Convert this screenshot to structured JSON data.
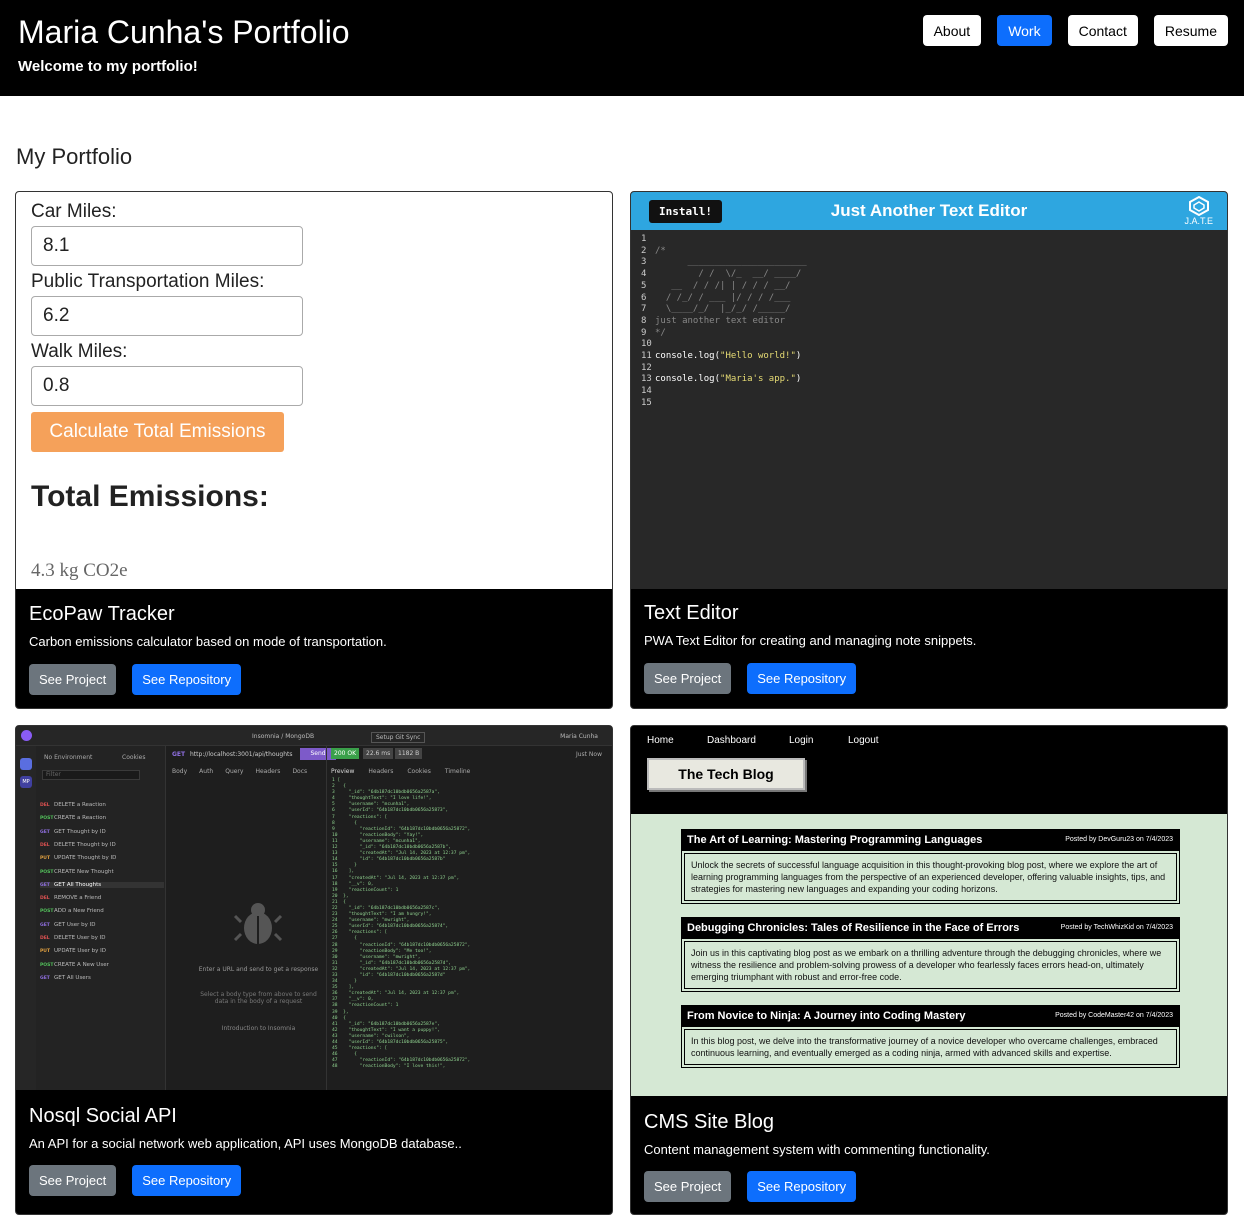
{
  "header": {
    "title": "Maria Cunha's Portfolio",
    "subtitle": "Welcome to my portfolio!",
    "nav": [
      {
        "label": "About",
        "active": false
      },
      {
        "label": "Work",
        "active": true
      },
      {
        "label": "Contact",
        "active": false
      },
      {
        "label": "Resume",
        "active": false
      }
    ]
  },
  "section_title": "My Portfolio",
  "buttons": {
    "project": "See Project",
    "repo": "See Repository"
  },
  "projects": [
    {
      "title": "EcoPaw Tracker",
      "description": "Carbon emissions calculator based on mode of transportation."
    },
    {
      "title": "Text Editor",
      "description": "PWA Text Editor for creating and managing note snippets."
    },
    {
      "title": "Nosql Social API",
      "description": "An API for a social network web application, API uses MongoDB database.."
    },
    {
      "title": "CMS Site Blog",
      "description": "Content management system with commenting functionality."
    }
  ],
  "eco": {
    "car_label": "Car Miles:",
    "car_value": "8.1",
    "public_label": "Public Transportation Miles:",
    "public_value": "6.2",
    "walk_label": "Walk Miles:",
    "walk_value": "0.8",
    "calc_button": "Calculate Total Emissions",
    "total_label": "Total Emissions:",
    "total_value": "4.3 kg CO2e"
  },
  "editor": {
    "install": "Install!",
    "title": "Just Another Text Editor",
    "logo_text": "J.A.T.E",
    "lines": [
      "1",
      "2",
      "3",
      "4",
      "5",
      "6",
      "7",
      "8",
      "9",
      "10",
      "11",
      "12",
      "13",
      "14",
      "15"
    ],
    "comment_open": "/*",
    "tagline": "just another text editor",
    "comment_close": "*/",
    "code1_fn": "console.log(",
    "code1_str": "\"Hello world!\"",
    "code1_end": ")",
    "code2_str": "\"Maria's app.\"",
    "code2_end": ")"
  },
  "nosql": {
    "app_title": "Insomnia / MongoDB",
    "env": "No Environment",
    "cookies": "Cookies",
    "filter": "Filter",
    "method": "GET",
    "url": "http://localhost:3001/api/thoughts",
    "send": "Send",
    "status": "200 OK",
    "time": "22.6 ms",
    "size": "1182 B",
    "just_now": "Just Now",
    "user": "Maria Cunha",
    "git": "Setup Git Sync",
    "tabs": [
      "Body",
      "Auth",
      "Query",
      "Headers",
      "Docs"
    ],
    "right_tabs": [
      "Preview",
      "Headers",
      "Cookies",
      "Timeline"
    ],
    "empty_title": "Enter a URL and send to get a response",
    "empty_sub": "Select a body type from above to send data in the body of a request",
    "intro": "Introduction to Insomnia",
    "requests": [
      {
        "m": "DEL",
        "label": "DELETE a Reaction",
        "c": "#e05252"
      },
      {
        "m": "POST",
        "label": "CREATE a Reaction",
        "c": "#52c05a"
      },
      {
        "m": "GET",
        "label": "GET Thought by ID",
        "c": "#8f6fe0"
      },
      {
        "m": "DEL",
        "label": "DELETE Thought by ID",
        "c": "#e05252"
      },
      {
        "m": "PUT",
        "label": "UPDATE Thought by ID",
        "c": "#e0a040"
      },
      {
        "m": "POST",
        "label": "CREATE New Thought",
        "c": "#52c05a"
      },
      {
        "m": "GET",
        "label": "GET All Thoughts",
        "c": "#8f6fe0"
      },
      {
        "m": "DEL",
        "label": "REMOVE a Friend",
        "c": "#e05252"
      },
      {
        "m": "POST",
        "label": "ADD a New Friend",
        "c": "#52c05a"
      },
      {
        "m": "GET",
        "label": "GET User by ID",
        "c": "#8f6fe0"
      },
      {
        "m": "DEL",
        "label": "DELETE User by ID",
        "c": "#e05252"
      },
      {
        "m": "PUT",
        "label": "UPDATE User by ID",
        "c": "#e0a040"
      },
      {
        "m": "POST",
        "label": "CREATE A New User",
        "c": "#52c05a"
      },
      {
        "m": "GET",
        "label": "GET All Users",
        "c": "#8f6fe0"
      }
    ],
    "json": "1 [\n2   {\n3     \"_id\": \"64b187dc10bdb0656a2587a\",\n4     \"thoughtText\": \"I love life!\",\n5     \"username\": \"mcunha1\",\n6     \"userId\": \"64b187dc10bdb0656a25873\",\n7     \"reactions\": [\n8       {\n9         \"reactionId\": \"64b187dc10bdb0656a25872\",\n10        \"reactionBody\": \"Yay!\",\n11        \"username\": \"mcunha1\",\n12        \"_id\": \"64b187dc10bdb0656a2587b\",\n13        \"createdAt\": \"Jul 14, 2023 at 12:37 pm\",\n14        \"id\": \"64b187dc10bdb0656a2587b\"\n15      }\n16    ],\n17    \"createdAt\": \"Jul 14, 2023 at 12:37 pm\",\n18    \"__v\": 0,\n19    \"reactionCount\": 1\n20  },\n21  {\n22    \"_id\": \"64b187dc10bdb0656a2587c\",\n23    \"thoughtText\": \"I am hungry!\",\n24    \"username\": \"mwright\",\n25    \"userId\": \"64b187dc10bdb0656a25874\",\n26    \"reactions\": [\n27      {\n28        \"reactionId\": \"64b187dc10bdb0656a25872\",\n29        \"reactionBody\": \"Me too!\",\n30        \"username\": \"mwright\",\n31        \"_id\": \"64b187dc10bdb0656a2587d\",\n32        \"createdAt\": \"Jul 14, 2023 at 12:37 pm\",\n33        \"id\": \"64b187dc10bdb0656a2587d\"\n34      }\n35    ],\n36    \"createdAt\": \"Jul 14, 2023 at 12:37 pm\",\n37    \"__v\": 0,\n38    \"reactionCount\": 1\n39  },\n40  {\n41    \"_id\": \"64b187dc10bdb0656a2587e\",\n42    \"thoughtText\": \"I want a puppy!\",\n43    \"username\": \"cwilson\",\n44    \"userId\": \"64b187dc10bdb0656a25875\",\n45    \"reactions\": [\n46      {\n47        \"reactionId\": \"64b187dc10bdb0656a25872\",\n48        \"reactionBody\": \"I love this!\","
  },
  "cms": {
    "nav": [
      "Home",
      "Dashboard",
      "Login",
      "Logout"
    ],
    "blog_title": "The Tech Blog",
    "posts": [
      {
        "title": "The Art of Learning: Mastering Programming Languages",
        "by": "Posted by DevGuru23 on 7/4/2023",
        "body": "Unlock the secrets of successful language acquisition in this thought-provoking blog post, where we explore the art of learning programming languages from the perspective of an experienced developer, offering valuable insights, tips, and strategies for mastering new languages and expanding your coding horizons."
      },
      {
        "title": "Debugging Chronicles: Tales of Resilience in the Face of Errors",
        "by": "Posted by TechWhizKid on 7/4/2023",
        "body": "Join us in this captivating blog post as we embark on a thrilling adventure through the debugging chronicles, where we witness the resilience and problem-solving prowess of a developer who fearlessly faces errors head-on, ultimately emerging triumphant with robust and error-free code."
      },
      {
        "title": "From Novice to Ninja: A Journey into Coding Mastery",
        "by": "Posted by CodeMaster42 on 7/4/2023",
        "body": "In this blog post, we delve into the transformative journey of a novice developer who overcame challenges, embraced continuous learning, and eventually emerged as a coding ninja, armed with advanced skills and expertise."
      }
    ]
  }
}
